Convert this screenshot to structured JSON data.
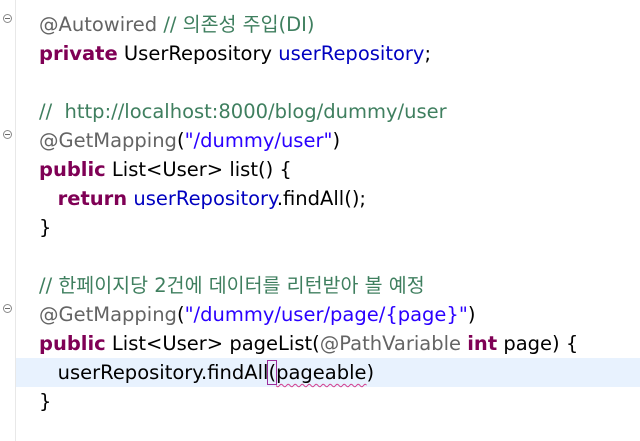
{
  "editor": {
    "lines": [
      {
        "a1": "@Autowired",
        "a2": " ",
        "c": "// 의존성 주입(DI)"
      },
      {
        "kw": "private",
        "t": " UserRepository ",
        "f": "userRepository",
        "e": ";"
      },
      {},
      {
        "c": "//  http://localhost:8000/blog/dummy/user"
      },
      {
        "a": "@GetMapping",
        "p1": "(",
        "s": "\"/dummy/user\"",
        "p2": ")"
      },
      {
        "kw": "public",
        "t": " List<User> list() {"
      },
      {
        "i": "   ",
        "kw": "return",
        "sp": " ",
        "f": "userRepository",
        "t": ".findAll();"
      },
      {
        "t": "}"
      },
      {},
      {
        "c": "// 한페이지당 2건에 데이터를 리턴받아 볼 예정"
      },
      {
        "a": "@GetMapping",
        "p1": "(",
        "s": "\"/dummy/user/page/{page}\"",
        "p2": ")"
      },
      {
        "kw": "public",
        "t1": " List<User> pageList(",
        "a": "@PathVariable",
        "sp": " ",
        "kw2": "int",
        "t2": " page) {"
      },
      {
        "i": "   ",
        "t1": "userRepository.findAll",
        "b": "(",
        "v": "pageable",
        "t2": ")"
      },
      {
        "t": "}"
      }
    ]
  }
}
